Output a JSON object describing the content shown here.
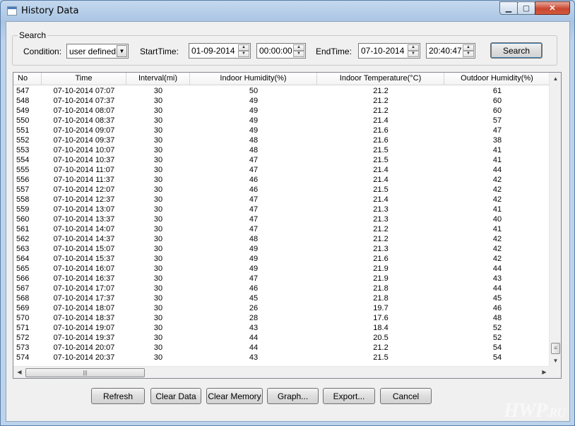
{
  "window": {
    "title": "History Data"
  },
  "search": {
    "group_label": "Search",
    "condition_label": "Condition:",
    "condition_value": "user defined",
    "start_label": "StartTime:",
    "start_date": "01-09-2014",
    "start_time": "00:00:00",
    "end_label": "EndTime:",
    "end_date": "07-10-2014",
    "end_time": "20:40:47",
    "search_button": "Search"
  },
  "table": {
    "columns": [
      "No",
      "Time",
      "Interval(mi)",
      "Indoor Humidity(%)",
      "Indoor Temperature(°C)",
      "Outdoor Humidity(%)"
    ],
    "rows": [
      [
        "547",
        "07-10-2014 07:07",
        "30",
        "50",
        "21.2",
        "61"
      ],
      [
        "548",
        "07-10-2014 07:37",
        "30",
        "49",
        "21.2",
        "60"
      ],
      [
        "549",
        "07-10-2014 08:07",
        "30",
        "49",
        "21.2",
        "60"
      ],
      [
        "550",
        "07-10-2014 08:37",
        "30",
        "49",
        "21.4",
        "57"
      ],
      [
        "551",
        "07-10-2014 09:07",
        "30",
        "49",
        "21.6",
        "47"
      ],
      [
        "552",
        "07-10-2014 09:37",
        "30",
        "48",
        "21.6",
        "38"
      ],
      [
        "553",
        "07-10-2014 10:07",
        "30",
        "48",
        "21.5",
        "41"
      ],
      [
        "554",
        "07-10-2014 10:37",
        "30",
        "47",
        "21.5",
        "41"
      ],
      [
        "555",
        "07-10-2014 11:07",
        "30",
        "47",
        "21.4",
        "44"
      ],
      [
        "556",
        "07-10-2014 11:37",
        "30",
        "46",
        "21.4",
        "42"
      ],
      [
        "557",
        "07-10-2014 12:07",
        "30",
        "46",
        "21.5",
        "42"
      ],
      [
        "558",
        "07-10-2014 12:37",
        "30",
        "47",
        "21.4",
        "42"
      ],
      [
        "559",
        "07-10-2014 13:07",
        "30",
        "47",
        "21.3",
        "41"
      ],
      [
        "560",
        "07-10-2014 13:37",
        "30",
        "47",
        "21.3",
        "40"
      ],
      [
        "561",
        "07-10-2014 14:07",
        "30",
        "47",
        "21.2",
        "41"
      ],
      [
        "562",
        "07-10-2014 14:37",
        "30",
        "48",
        "21.2",
        "42"
      ],
      [
        "563",
        "07-10-2014 15:07",
        "30",
        "49",
        "21.3",
        "42"
      ],
      [
        "564",
        "07-10-2014 15:37",
        "30",
        "49",
        "21.6",
        "42"
      ],
      [
        "565",
        "07-10-2014 16:07",
        "30",
        "49",
        "21.9",
        "44"
      ],
      [
        "566",
        "07-10-2014 16:37",
        "30",
        "47",
        "21.9",
        "43"
      ],
      [
        "567",
        "07-10-2014 17:07",
        "30",
        "46",
        "21.8",
        "44"
      ],
      [
        "568",
        "07-10-2014 17:37",
        "30",
        "45",
        "21.8",
        "45"
      ],
      [
        "569",
        "07-10-2014 18:07",
        "30",
        "26",
        "19.7",
        "46"
      ],
      [
        "570",
        "07-10-2014 18:37",
        "30",
        "28",
        "17.6",
        "48"
      ],
      [
        "571",
        "07-10-2014 19:07",
        "30",
        "43",
        "18.4",
        "52"
      ],
      [
        "572",
        "07-10-2014 19:37",
        "30",
        "44",
        "20.5",
        "52"
      ],
      [
        "573",
        "07-10-2014 20:07",
        "30",
        "44",
        "21.2",
        "54"
      ],
      [
        "574",
        "07-10-2014 20:37",
        "30",
        "43",
        "21.5",
        "54"
      ]
    ]
  },
  "buttons": {
    "refresh": "Refresh",
    "clear_data": "Clear Data",
    "clear_memory": "Clear Memory",
    "graph": "Graph...",
    "export": "Export...",
    "cancel": "Cancel"
  },
  "watermark": {
    "main": "HWP",
    "suffix": ".RU"
  },
  "icons": {
    "dropdown": "chevron-down-icon",
    "spin_up": "spin-up-icon",
    "spin_down": "spin-down-icon",
    "window": "window-icon"
  },
  "colors": {
    "frame": "#b9d1ea",
    "client": "#f0f0f0",
    "close_button": "#c94630",
    "focus_border": "#3c7fb1"
  }
}
